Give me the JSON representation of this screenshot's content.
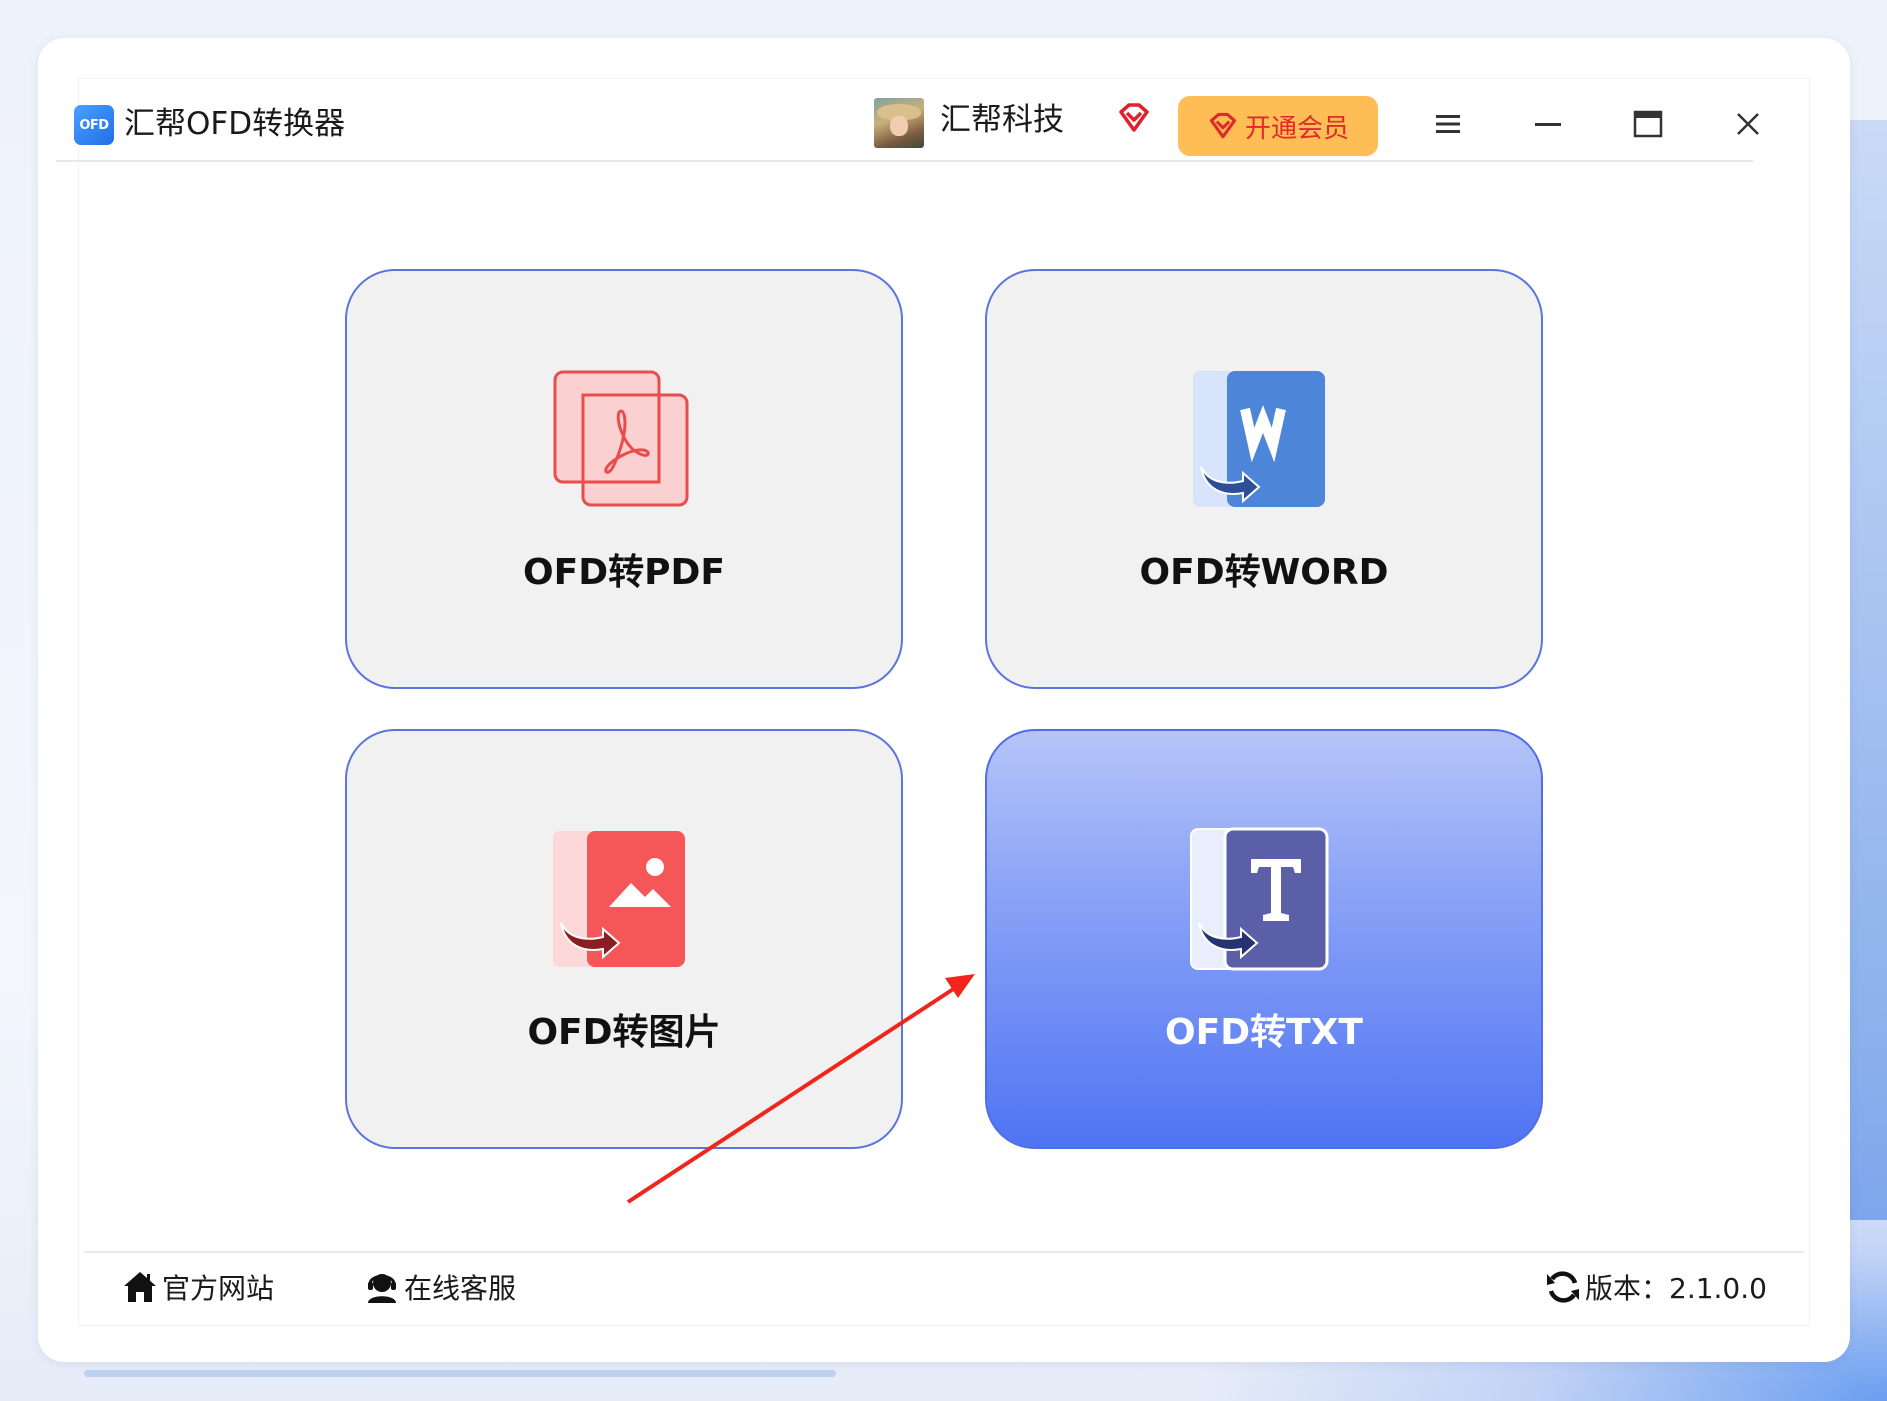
{
  "app": {
    "logo_text": "OFD",
    "title": "汇帮OFD转换器"
  },
  "header": {
    "company": "汇帮科技",
    "member_button": "开通会员"
  },
  "cards": [
    {
      "label": "OFD转PDF",
      "icon": "pdf-document-icon"
    },
    {
      "label": "OFD转WORD",
      "icon": "word-document-icon"
    },
    {
      "label": "OFD转图片",
      "icon": "image-document-icon"
    },
    {
      "label": "OFD转TXT",
      "icon": "txt-document-icon",
      "active": true
    }
  ],
  "footer": {
    "website": "官方网站",
    "support": "在线客服",
    "version": "版本：2.1.0.0"
  },
  "colors": {
    "accent": "#4f74f4",
    "card_border": "#5b74de",
    "member_bg": "#ffbe55",
    "member_text": "#e02a2a",
    "annotation_arrow": "#f0261d"
  }
}
